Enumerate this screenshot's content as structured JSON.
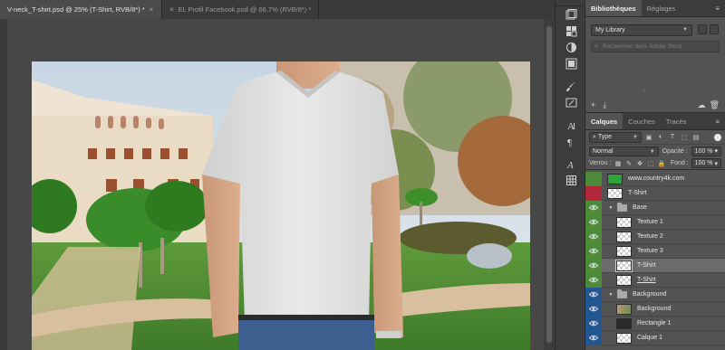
{
  "document_tabs": [
    {
      "label": "V-neck_T-shirt.psd @ 25% (T-Shirt, RVB/8*) *",
      "active": true
    },
    {
      "label": "EL Profil Facebook.psd @ 66,7% (RVB/8*) *",
      "active": false
    }
  ],
  "tools": [
    "history-icon",
    "swatches-icon",
    "adjustments-icon",
    "styles-icon",
    "brush-icon",
    "brush-presets-icon",
    "character-icon",
    "paragraph-icon",
    "glyphs-icon",
    "properties-icon"
  ],
  "libraries_panel": {
    "tabs": [
      "Bibliothèques",
      "Réglages"
    ],
    "library_select": "My Library",
    "search_placeholder": "Rechercher dans Adobe Stock"
  },
  "layers_panel": {
    "tabs": [
      "Calques",
      "Couches",
      "Tracés"
    ],
    "filter_kind": "Type",
    "blend_mode": "Normal",
    "opacity_label": "Opacité :",
    "opacity_value": "100 %",
    "lock_label": "Verrou :",
    "fill_label": "Fond :",
    "fill_value": "100 %",
    "layers": [
      {
        "name": "www.country4k.com",
        "color": "#4d8a3a",
        "visible": false,
        "kind": "solid-green",
        "indent": 0
      },
      {
        "name": "T-Shirt",
        "color": "#b3273b",
        "visible": false,
        "kind": "checker",
        "indent": 0
      },
      {
        "name": "Base",
        "color": "#4d8a3a",
        "visible": true,
        "kind": "group",
        "indent": 0
      },
      {
        "name": "Texture 1",
        "color": "#4d8a3a",
        "visible": true,
        "kind": "checker",
        "indent": 1
      },
      {
        "name": "Texture 2",
        "color": "#4d8a3a",
        "visible": true,
        "kind": "checker",
        "indent": 1
      },
      {
        "name": "Texture 3",
        "color": "#4d8a3a",
        "visible": true,
        "kind": "checker",
        "indent": 1
      },
      {
        "name": "T-Shirt",
        "color": "#4d8a3a",
        "visible": true,
        "kind": "smart",
        "indent": 1,
        "selected": true
      },
      {
        "name": "T-Shirt",
        "color": "#4d8a3a",
        "visible": true,
        "kind": "checker",
        "indent": 1,
        "underline": true
      },
      {
        "name": "Background",
        "color": "#24568f",
        "visible": true,
        "kind": "group",
        "indent": 0
      },
      {
        "name": "Background",
        "color": "#24568f",
        "visible": true,
        "kind": "photo",
        "indent": 1
      },
      {
        "name": "Rectangle 1",
        "color": "#24568f",
        "visible": true,
        "kind": "dark",
        "indent": 1
      },
      {
        "name": "Calque 1",
        "color": "#24568f",
        "visible": true,
        "kind": "checker",
        "indent": 1
      }
    ]
  }
}
